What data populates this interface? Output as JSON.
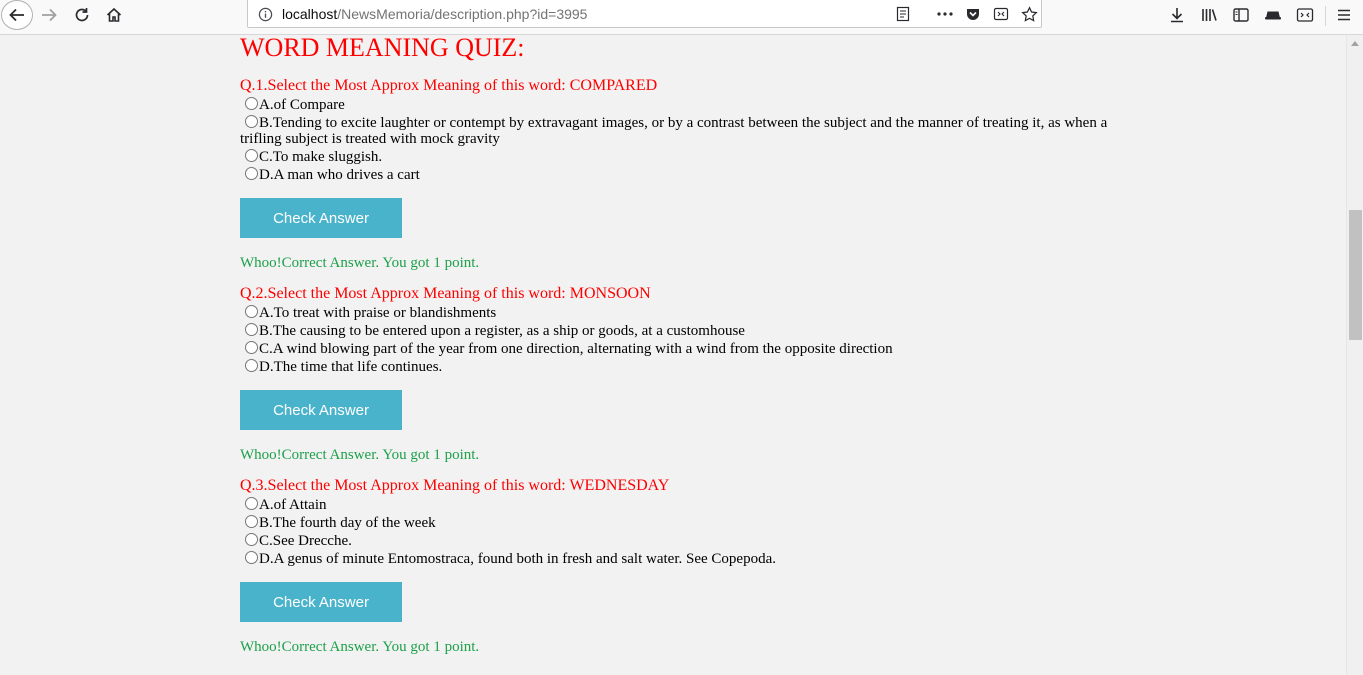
{
  "browser": {
    "url_prefix": "",
    "url_host": "localhost",
    "url_path": "/NewsMemoria/description.php?id=3995"
  },
  "page": {
    "title": "WORD MEANING QUIZ:",
    "check_label": "Check Answer",
    "result_text": "Whoo!Correct Answer. You got 1 point."
  },
  "questions": [
    {
      "text": "Q.1.Select the Most Approx Meaning of this word: COMPARED",
      "options": [
        "A.of Compare",
        "B.Tending to excite laughter or contempt by extravagant images, or by a contrast between the subject and the manner of treating it, as when a trifling subject is treated with mock gravity",
        "C.To make sluggish.",
        "D.A man who drives a cart"
      ]
    },
    {
      "text": "Q.2.Select the Most Approx Meaning of this word: MONSOON",
      "options": [
        "A.To treat with praise or blandishments",
        "B.The causing to be entered upon a register, as a ship or goods, at a customhouse",
        "C.A wind blowing part of the year from one direction, alternating with a wind from the opposite direction",
        "D.The time that life continues."
      ]
    },
    {
      "text": "Q.3.Select the Most Approx Meaning of this word: WEDNESDAY",
      "options": [
        "A.of Attain",
        "B.The fourth day of the week",
        "C.See Drecche.",
        "D.A genus of minute Entomostraca, found both in fresh and salt water. See Copepoda."
      ]
    }
  ]
}
